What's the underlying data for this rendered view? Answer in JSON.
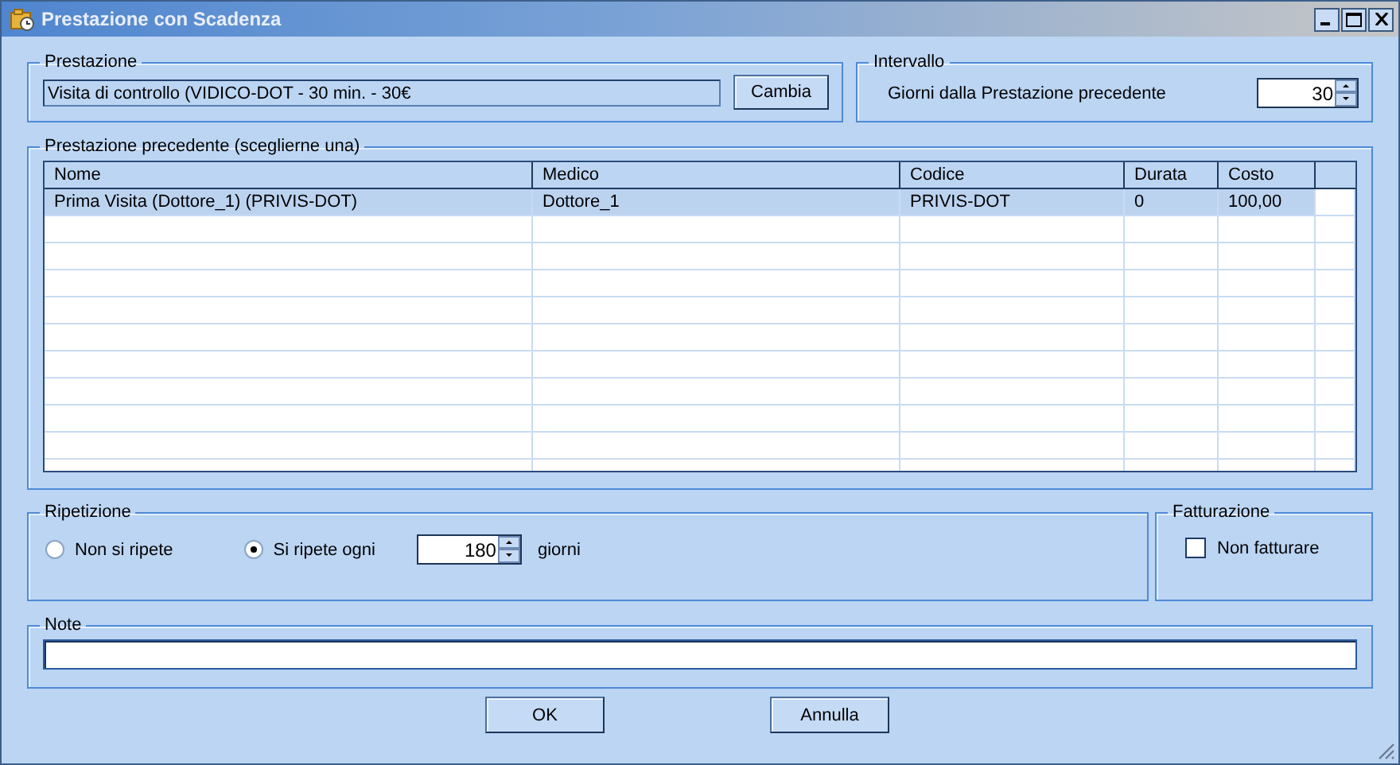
{
  "window": {
    "title": "Prestazione con Scadenza"
  },
  "prestazione": {
    "legend": "Prestazione",
    "value": "Visita di controllo (VIDICO-DOT - 30 min. - 30€",
    "button": "Cambia"
  },
  "intervallo": {
    "legend": "Intervallo",
    "label": "Giorni dalla Prestazione precedente",
    "value": "30"
  },
  "precedente": {
    "legend": "Prestazione precedente (sceglierne una)",
    "columns": [
      "Nome",
      "Medico",
      "Codice",
      "Durata",
      "Costo"
    ],
    "rows": [
      {
        "cells": [
          "Prima Visita (Dottore_1) (PRIVIS-DOT)",
          "Dottore_1",
          "PRIVIS-DOT",
          "0",
          "100,00"
        ],
        "selected": true
      }
    ]
  },
  "ripetizione": {
    "legend": "Ripetizione",
    "options": [
      {
        "label": "Non si ripete",
        "selected": false
      },
      {
        "label": "Si ripete ogni",
        "selected": true
      }
    ],
    "value": "180",
    "unit": "giorni"
  },
  "fatturazione": {
    "legend": "Fatturazione",
    "label": "Non fatturare",
    "checked": false
  },
  "note": {
    "legend": "Note"
  },
  "buttons": [
    "OK",
    "Annulla"
  ]
}
